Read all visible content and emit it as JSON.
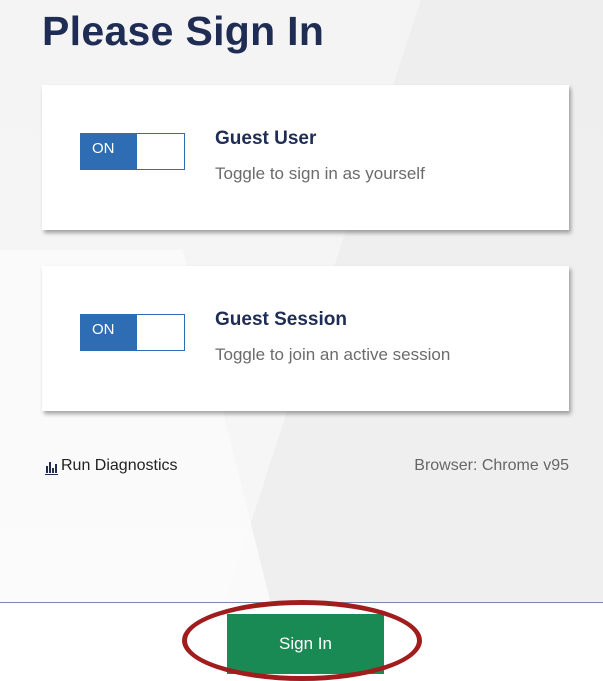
{
  "page": {
    "title": "Please Sign In"
  },
  "cards": [
    {
      "toggle_label": "ON",
      "title": "Guest User",
      "description": "Toggle to sign in as yourself"
    },
    {
      "toggle_label": "ON",
      "title": "Guest Session",
      "description": "Toggle to join an active session"
    }
  ],
  "footer": {
    "diagnostics_icon": "bar-chart-icon",
    "diagnostics_label": "Run Diagnostics",
    "browser_info": "Browser: Chrome v95"
  },
  "actions": {
    "sign_in_label": "Sign In"
  },
  "colors": {
    "title": "#1f2d55",
    "toggle_on": "#2e6db4",
    "sign_in_button": "#1a8a55",
    "highlight_ring": "#a11c1c"
  }
}
